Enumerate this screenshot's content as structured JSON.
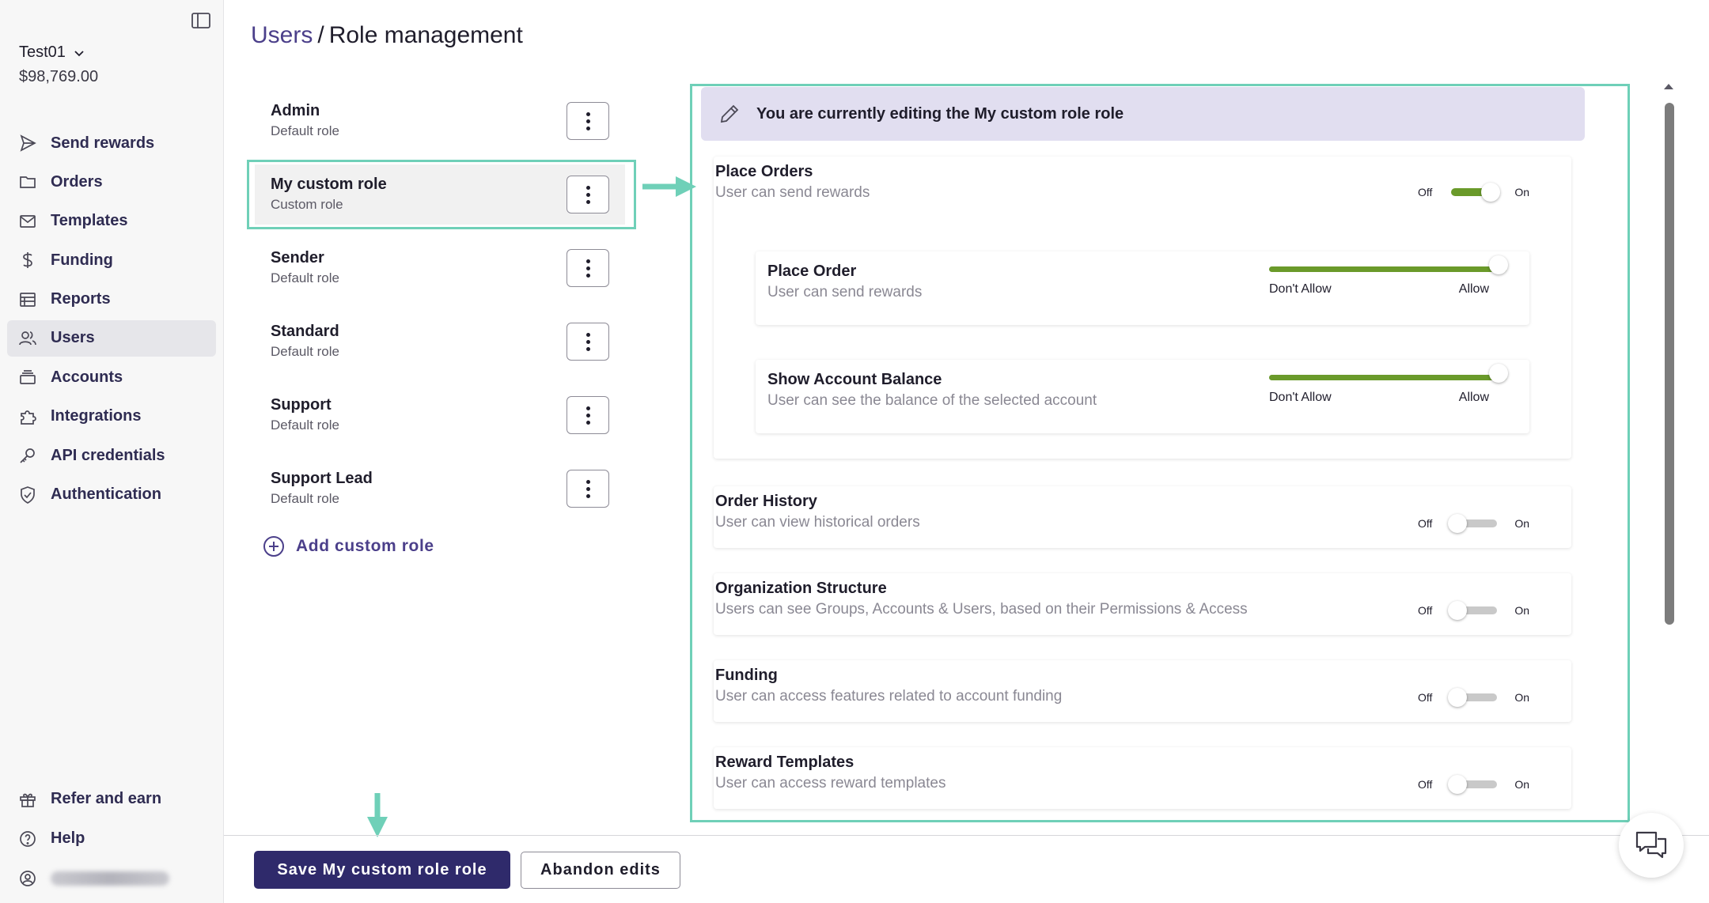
{
  "sidebar": {
    "account_name": "Test01",
    "account_balance": "$98,769.00",
    "items": [
      {
        "label": "Send rewards",
        "icon": "send-icon"
      },
      {
        "label": "Orders",
        "icon": "folder-icon"
      },
      {
        "label": "Templates",
        "icon": "mail-icon"
      },
      {
        "label": "Funding",
        "icon": "dollar-icon"
      },
      {
        "label": "Reports",
        "icon": "table-icon"
      },
      {
        "label": "Users",
        "icon": "users-icon",
        "active": true
      },
      {
        "label": "Accounts",
        "icon": "stack-icon"
      },
      {
        "label": "Integrations",
        "icon": "puzzle-icon"
      },
      {
        "label": "API credentials",
        "icon": "key-icon"
      },
      {
        "label": "Authentication",
        "icon": "shield-icon"
      }
    ],
    "bottom": [
      {
        "label": "Refer and earn",
        "icon": "gift-icon"
      },
      {
        "label": "Help",
        "icon": "help-icon"
      }
    ]
  },
  "header": {
    "crumb_link": "Users",
    "separator": "/",
    "title": "Role management"
  },
  "roles": [
    {
      "name": "Admin",
      "type": "Default role"
    },
    {
      "name": "My custom role",
      "type": "Custom role",
      "selected": true
    },
    {
      "name": "Sender",
      "type": "Default role"
    },
    {
      "name": "Standard",
      "type": "Default role"
    },
    {
      "name": "Support",
      "type": "Default role"
    },
    {
      "name": "Support Lead",
      "type": "Default role"
    }
  ],
  "add_role_label": "Add custom role",
  "editor": {
    "banner": "You are currently editing the My custom role role",
    "toggle_off_label": "Off",
    "toggle_on_label": "On",
    "slider_low_label": "Don't Allow",
    "slider_high_label": "Allow",
    "permissions": [
      {
        "title": "Place Orders",
        "description": "User can send rewards",
        "enabled": true,
        "sub": [
          {
            "title": "Place Order",
            "description": "User can send rewards",
            "level": 1
          },
          {
            "title": "Show Account Balance",
            "description": "User can see the balance of the selected account",
            "level": 1
          }
        ]
      },
      {
        "title": "Order History",
        "description": "User can view historical orders",
        "enabled": false
      },
      {
        "title": "Organization Structure",
        "description": "Users can see Groups, Accounts & Users, based on their Permissions & Access",
        "enabled": false
      },
      {
        "title": "Funding",
        "description": "User can access features related to account funding",
        "enabled": false
      },
      {
        "title": "Reward Templates",
        "description": "User can access reward templates",
        "enabled": false
      }
    ]
  },
  "footer": {
    "save_label": "Save My custom role role",
    "abandon_label": "Abandon edits"
  },
  "colors": {
    "accent": "#2f2a6b",
    "link": "#4b3f8a",
    "toggle_on": "#6a9a2a",
    "highlight": "#6fd0b8",
    "banner_bg": "#e1def0"
  }
}
